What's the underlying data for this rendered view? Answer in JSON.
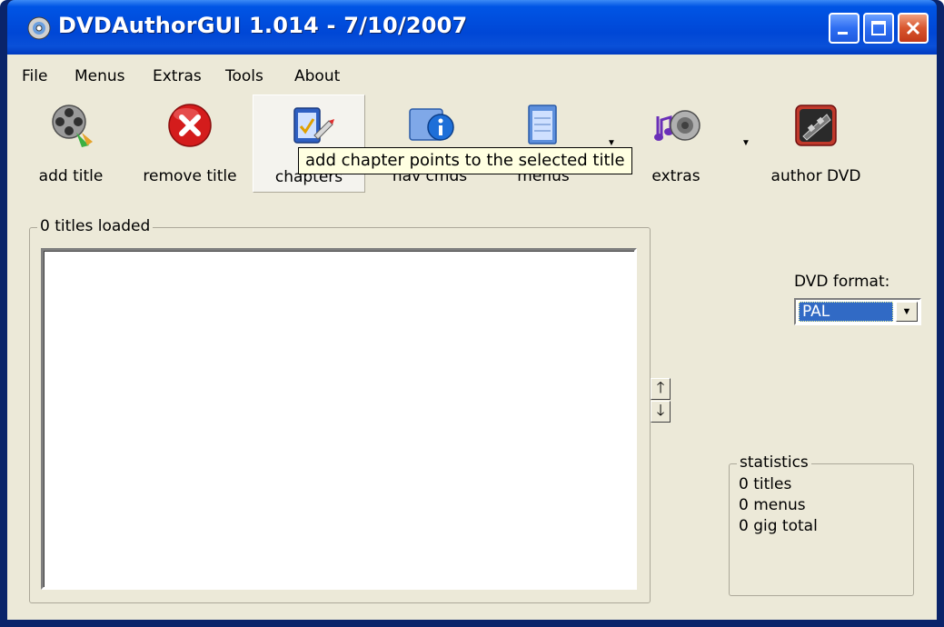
{
  "window": {
    "title": "DVDAuthorGUI 1.014 - 7/10/2007"
  },
  "menu": {
    "items": [
      "File",
      "Menus",
      "Extras",
      "Tools",
      "About"
    ]
  },
  "toolbar": {
    "add_title": "add title",
    "remove_title": "remove title",
    "chapters": "chapters",
    "nav_cmds": "nav cmds",
    "menus": "menus",
    "extras": "extras",
    "author_dvd": "author DVD"
  },
  "tooltip": {
    "text": "add chapter points to the selected title"
  },
  "titles_group": {
    "label": "0 titles loaded"
  },
  "dvd_format": {
    "label": "DVD format:",
    "selected": "PAL"
  },
  "statistics": {
    "label": "statistics",
    "titles": "0 titles",
    "menus": "0 menus",
    "total": "0 gig total"
  },
  "colors": {
    "titlebar": "#0055e5",
    "window_bg": "#ece9d8",
    "tooltip_bg": "#ffffe1",
    "selection": "#316ac5"
  }
}
